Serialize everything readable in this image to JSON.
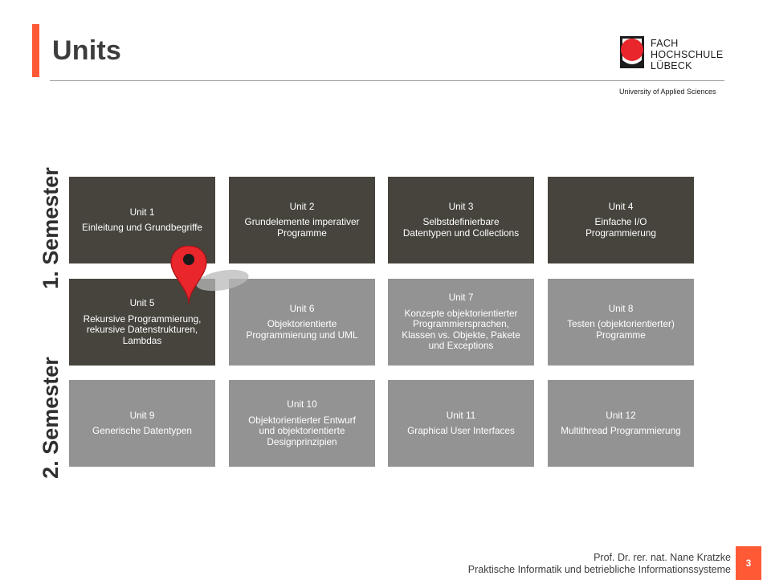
{
  "slide": {
    "title": "Units",
    "logo": {
      "line1": "FACH",
      "line2": "HOCHSCHULE",
      "line3": "LÜBECK",
      "tagline": "University of Applied Sciences"
    },
    "semesters": [
      "1. Semester",
      "2. Semester"
    ],
    "units": [
      {
        "number": "Unit 1",
        "title": "Einleitung und Grundbegriffe"
      },
      {
        "number": "Unit 2",
        "title": "Grundelemente imperativer\nProgramme"
      },
      {
        "number": "Unit 3",
        "title": "Selbstdefinierbare\nDatentypen und Collections"
      },
      {
        "number": "Unit 4",
        "title": "Einfache I/O\nProgrammierung"
      },
      {
        "number": "Unit 5",
        "title": "Rekursive Programmierung,\nrekursive Datenstrukturen,\nLambdas"
      },
      {
        "number": "Unit 6",
        "title": "Objektorientierte\nProgrammierung und UML"
      },
      {
        "number": "Unit 7",
        "title": "Konzepte objektorientierter\nProgrammiersprachen,\nKlassen vs. Objekte, Pakete\nund Exceptions"
      },
      {
        "number": "Unit 8",
        "title": "Testen (objektorientierter)\nProgramme"
      },
      {
        "number": "Unit 9",
        "title": "Generische Datentypen"
      },
      {
        "number": "Unit 10",
        "title": "Objektorientierter Entwurf\nund objektorientierte\nDesignprinzipien"
      },
      {
        "number": "Unit 11",
        "title": "Graphical User Interfaces"
      },
      {
        "number": "Unit 12",
        "title": "Multithread Programmierung"
      }
    ],
    "current_unit_marker": "map-pin-icon",
    "footer": {
      "author": "Prof. Dr. rer. nat. Nane Kratzke",
      "course": "Praktische Informatik und betriebliche Informationssysteme",
      "page": "3"
    },
    "colors": {
      "accent": "#ff5a36",
      "tile_completed": "#46443d",
      "tile_upcoming": "#939393",
      "pin": "#e8262b"
    }
  }
}
